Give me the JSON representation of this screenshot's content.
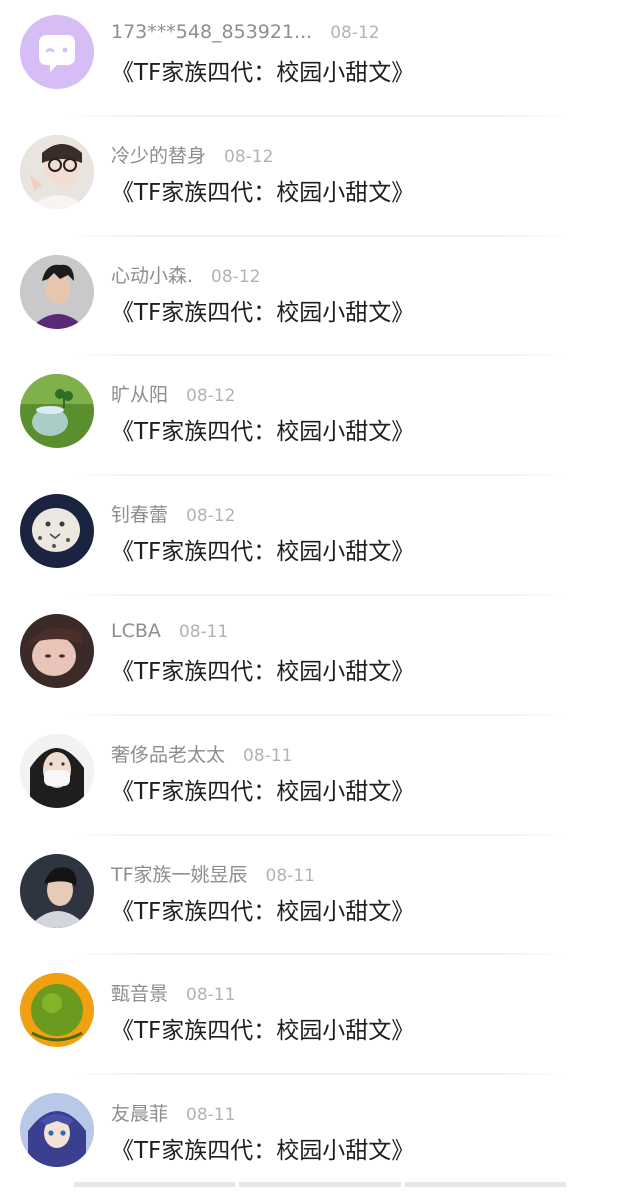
{
  "items": [
    {
      "user": "173***548_853921...",
      "date": "08-12",
      "title": "《TF家族四代：校园小甜文》",
      "avatar": "chat-bubble-icon"
    },
    {
      "user": "冷少的替身",
      "date": "08-12",
      "title": "《TF家族四代：校园小甜文》",
      "avatar": "girl-glasses-photo"
    },
    {
      "user": "心动小森.",
      "date": "08-12",
      "title": "《TF家族四代：校园小甜文》",
      "avatar": "boy-purple-photo"
    },
    {
      "user": "旷从阳",
      "date": "08-12",
      "title": "《TF家族四代：校园小甜文》",
      "avatar": "clover-jar-photo"
    },
    {
      "user": "钊春蕾",
      "date": "08-12",
      "title": "《TF家族四代：校园小甜文》",
      "avatar": "snow-leopard-photo"
    },
    {
      "user": "LCBA",
      "date": "08-11",
      "title": "《TF家族四代：校园小甜文》",
      "avatar": "girl-face-photo"
    },
    {
      "user": "奢侈品老太太",
      "date": "08-11",
      "title": "《TF家族四代：校园小甜文》",
      "avatar": "masked-girl-photo"
    },
    {
      "user": "TF家族一姚昱辰",
      "date": "08-11",
      "title": "《TF家族四代：校园小甜文》",
      "avatar": "boy-hoodie-photo"
    },
    {
      "user": "甄音景",
      "date": "08-11",
      "title": "《TF家族四代：校园小甜文》",
      "avatar": "green-ball-photo"
    },
    {
      "user": "友晨菲",
      "date": "08-11",
      "title": "《TF家族四代：校园小甜文》",
      "avatar": "anime-girl-photo"
    }
  ],
  "colors": {
    "accent_purple": "#d2b8f2",
    "name_gray": "#8e8e8e",
    "date_gray": "#b3b3b3",
    "title_black": "#1f1f1f"
  }
}
